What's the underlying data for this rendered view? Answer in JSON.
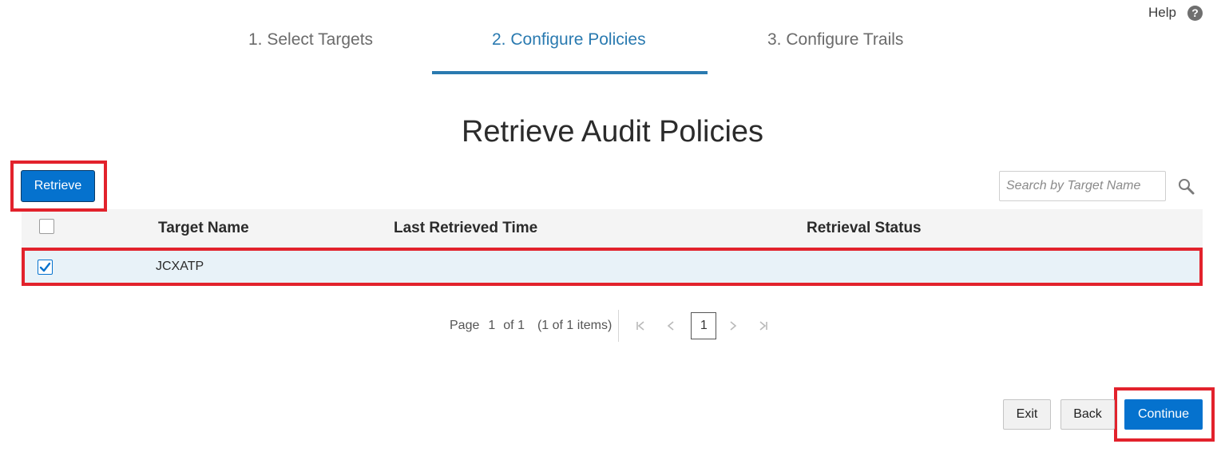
{
  "help": {
    "label": "Help",
    "icon": "help-circle-icon"
  },
  "steps": [
    {
      "label": "1. Select Targets",
      "active": false
    },
    {
      "label": "2. Configure Policies",
      "active": true
    },
    {
      "label": "3. Configure Trails",
      "active": false
    }
  ],
  "title": "Retrieve Audit Policies",
  "toolbar": {
    "retrieve_label": "Retrieve",
    "search_placeholder": "Search by Target Name",
    "search_value": ""
  },
  "table": {
    "columns": [
      "Target Name",
      "Last Retrieved Time",
      "Retrieval Status"
    ],
    "rows": [
      {
        "selected": true,
        "target_name": "JCXATP",
        "last_retrieved_time": "",
        "retrieval_status": ""
      }
    ]
  },
  "pagination": {
    "page_label": "Page",
    "current_page": "1",
    "of_label": "of 1",
    "items_label": "(1 of 1 items)",
    "current_button": "1"
  },
  "footer": {
    "exit_label": "Exit",
    "back_label": "Back",
    "continue_label": "Continue"
  },
  "colors": {
    "accent": "#0572ce",
    "active_step": "#2a7ab0",
    "highlight_box": "#e2222c",
    "selected_row": "#e8f2f8"
  }
}
